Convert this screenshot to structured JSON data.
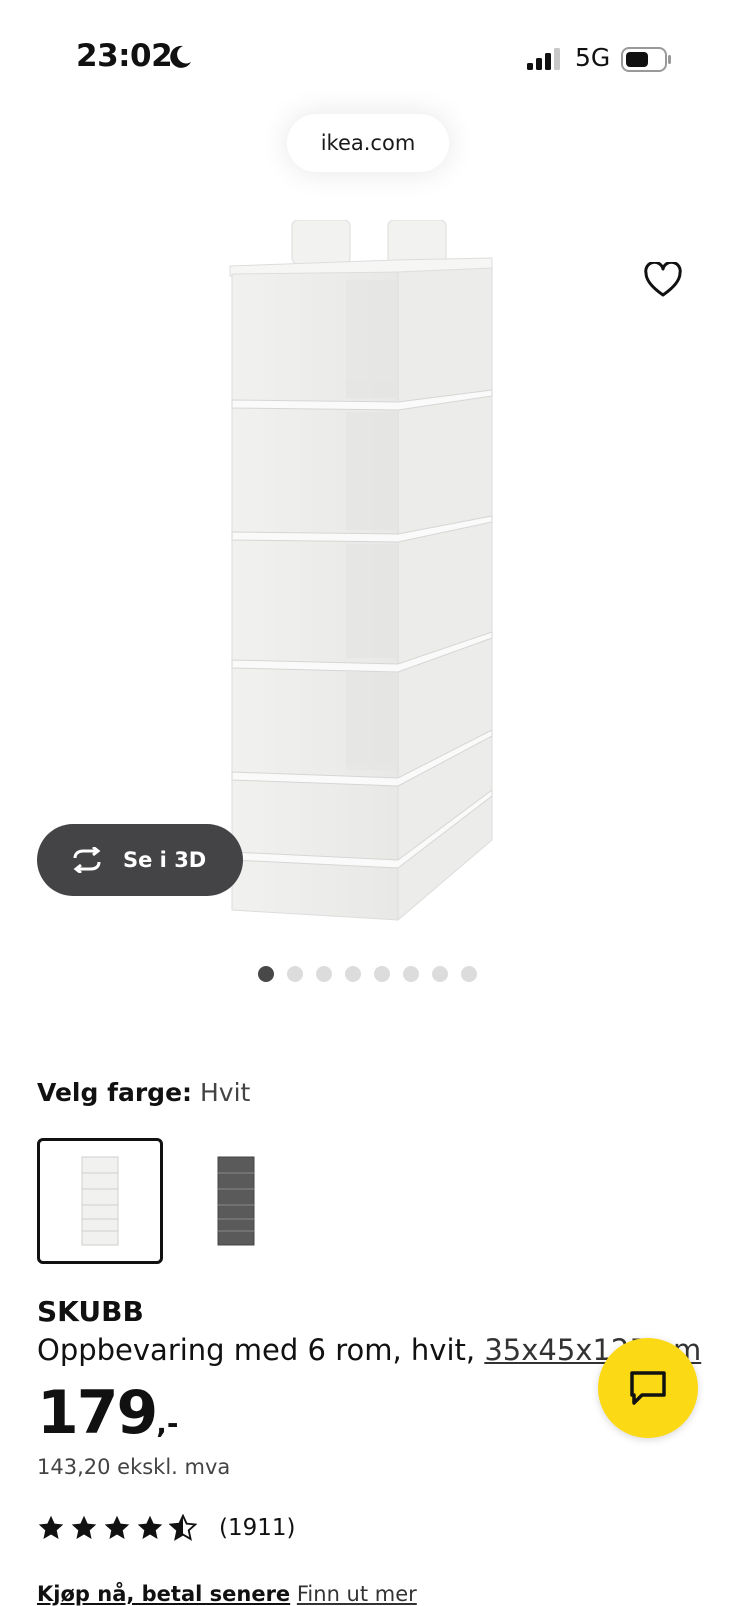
{
  "status_bar": {
    "time": "23:02",
    "network": "5G"
  },
  "browser": {
    "url": "ikea.com"
  },
  "gallery": {
    "view_3d_label": "Se i 3D",
    "image_count": 8,
    "active_index": 0
  },
  "color_selector": {
    "label": "Velg farge:",
    "selected": "Hvit",
    "options": [
      {
        "name": "Hvit",
        "color": "#f4f4f2"
      },
      {
        "name": "grey",
        "color": "#5a5a5a"
      }
    ]
  },
  "product": {
    "name": "SKUBB",
    "description": "Oppbevaring med 6 rom, hvit, ",
    "dimensions": "35x45x125 cm",
    "price_integer": "179",
    "price_suffix": ",-",
    "price_excl_vat": "143,20 ekskl. mva",
    "rating": 4.5,
    "rating_max": 5,
    "review_count": "(1911)"
  },
  "payment": {
    "lead": "Kjøp nå, betal senere",
    "more": "Finn ut mer"
  },
  "colors": {
    "accent_yellow": "#fbd914",
    "button_dark": "#444446"
  }
}
